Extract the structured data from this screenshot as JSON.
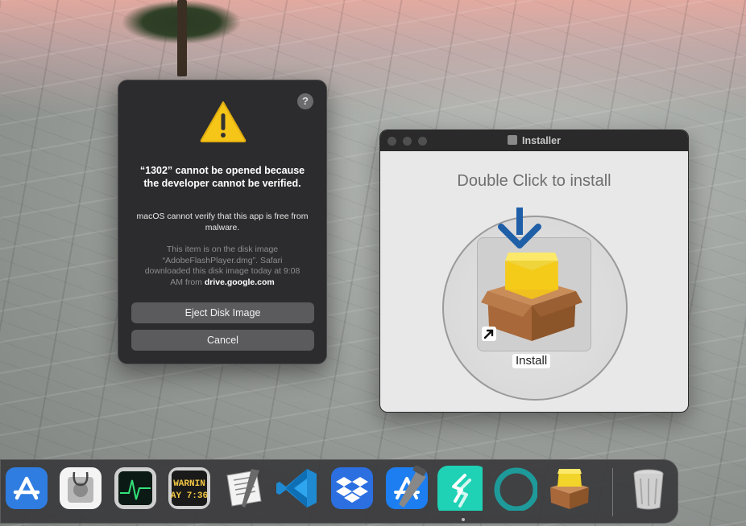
{
  "alert": {
    "title": "“1302” cannot be opened because the developer cannot be verified.",
    "message": "macOS cannot verify that this app is free from malware.",
    "info_prefix": "This item is on the disk image “AdobeFlashPlayer.dmg”. Safari downloaded this disk image today at 9:08 AM from ",
    "info_domain": "drive.google.com",
    "help_label": "?",
    "eject_label": "Eject Disk Image",
    "cancel_label": "Cancel",
    "icon": "warning-icon"
  },
  "installer": {
    "title": "Installer",
    "heading": "Double Click to install",
    "app_label": "Install",
    "icons": [
      "disk-icon",
      "down-arrow-icon",
      "package-icon",
      "alias-arrow-icon"
    ]
  },
  "dock": {
    "items": [
      {
        "name": "App Store",
        "icon": "app-store-icon"
      },
      {
        "name": "Disk Utility",
        "icon": "disk-utility-icon"
      },
      {
        "name": "Activity Monitor",
        "icon": "activity-monitor-icon"
      },
      {
        "name": "Console",
        "icon": "console-icon",
        "text_line1": "WARNIN",
        "text_line2": "AY 7:36"
      },
      {
        "name": "Script Editor",
        "icon": "script-editor-icon"
      },
      {
        "name": "Visual Studio Code",
        "icon": "vscode-icon"
      },
      {
        "name": "Dropbox",
        "icon": "dropbox-icon"
      },
      {
        "name": "Xcode",
        "icon": "xcode-icon"
      },
      {
        "name": "Setapp",
        "icon": "setapp-icon"
      },
      {
        "name": "Circle App",
        "icon": "ring-app-icon"
      },
      {
        "name": "Installer",
        "icon": "installer-package-icon"
      },
      {
        "name": "Trash",
        "icon": "trash-icon"
      }
    ]
  },
  "colors": {
    "alert_bg": "#2c2c2e",
    "button_bg": "#5b5b5d",
    "warning_yellow": "#f5c518",
    "arrow_blue": "#1f5fa8",
    "setapp_teal": "#1fd1b5"
  }
}
